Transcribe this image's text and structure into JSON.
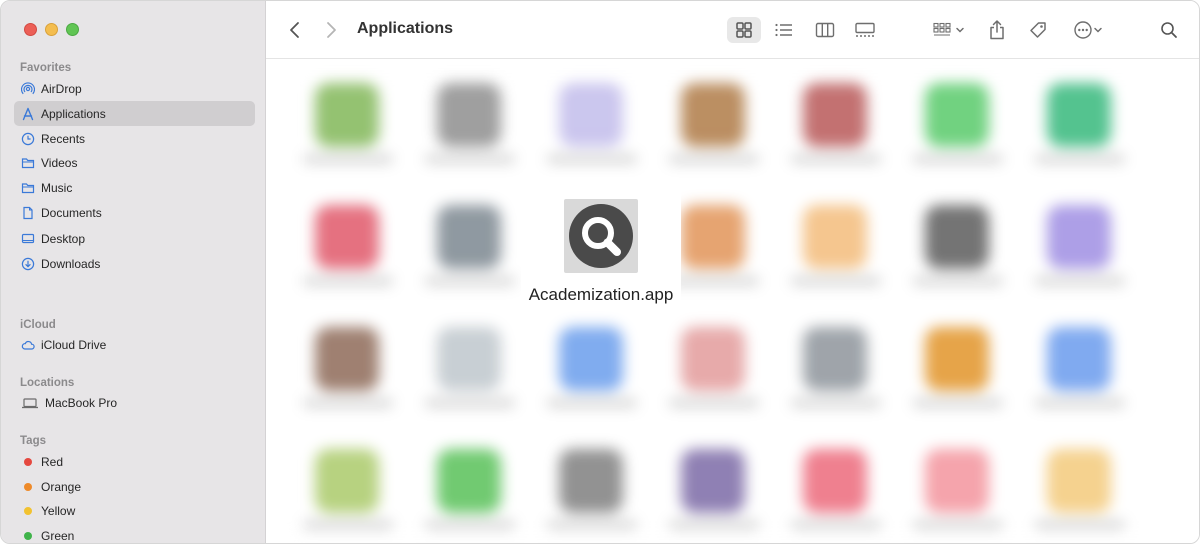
{
  "window": {
    "title": "Applications"
  },
  "sidebar": {
    "favorites_title": "Favorites",
    "favorites": [
      {
        "label": "AirDrop",
        "icon": "airdrop-icon"
      },
      {
        "label": "Applications",
        "icon": "applications-icon",
        "selected": true
      },
      {
        "label": "Recents",
        "icon": "clock-icon"
      },
      {
        "label": "Videos",
        "icon": "folder-icon"
      },
      {
        "label": "Music",
        "icon": "folder-icon"
      },
      {
        "label": "Documents",
        "icon": "document-icon"
      },
      {
        "label": "Desktop",
        "icon": "desktop-icon"
      },
      {
        "label": "Downloads",
        "icon": "download-icon"
      }
    ],
    "icloud_title": "iCloud",
    "icloud": [
      {
        "label": "iCloud Drive",
        "icon": "cloud-icon"
      }
    ],
    "locations_title": "Locations",
    "locations": [
      {
        "label": "MacBook Pro",
        "icon": "laptop-icon"
      }
    ],
    "tags_title": "Tags",
    "tags": [
      {
        "label": "Red",
        "color": "#e5483f"
      },
      {
        "label": "Orange",
        "color": "#ee8a2a"
      },
      {
        "label": "Yellow",
        "color": "#f2c230"
      },
      {
        "label": "Green",
        "color": "#3fb34a"
      }
    ]
  },
  "content": {
    "focus_app": {
      "label": "Academization.app",
      "icon": "search-magnifier-icon"
    }
  },
  "colors": {
    "sidebar_bg": "#e7e5e7",
    "selected_bg": "#d0ced0",
    "icon_accent": "#3a79d8"
  }
}
